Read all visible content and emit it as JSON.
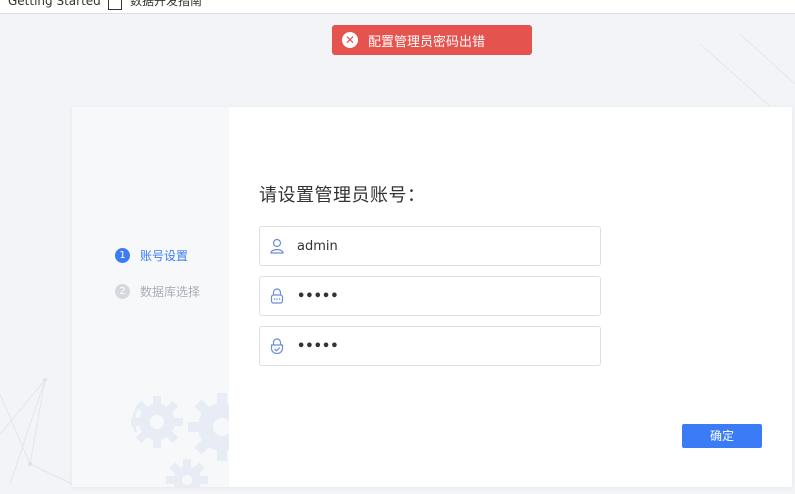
{
  "browser": {
    "bookmark_1": "Getting Started",
    "bookmark_2": "数据开发指南"
  },
  "toast": {
    "icon": "close-circle-icon",
    "message": "配置管理员密码出错",
    "color": "#e5534f"
  },
  "steps": [
    {
      "number": "1",
      "label": "账号设置",
      "state": "active"
    },
    {
      "number": "2",
      "label": "数据库选择",
      "state": "inactive"
    }
  ],
  "form": {
    "title": "请设置管理员账号：",
    "username": {
      "icon": "user-icon",
      "value": "admin"
    },
    "password": {
      "icon": "lock-icon",
      "value": "•••••"
    },
    "confirm_password": {
      "icon": "shield-lock-icon",
      "value": "•••••"
    },
    "submit_label": "确定"
  },
  "colors": {
    "accent": "#3b7cf6",
    "error": "#e5534f"
  }
}
